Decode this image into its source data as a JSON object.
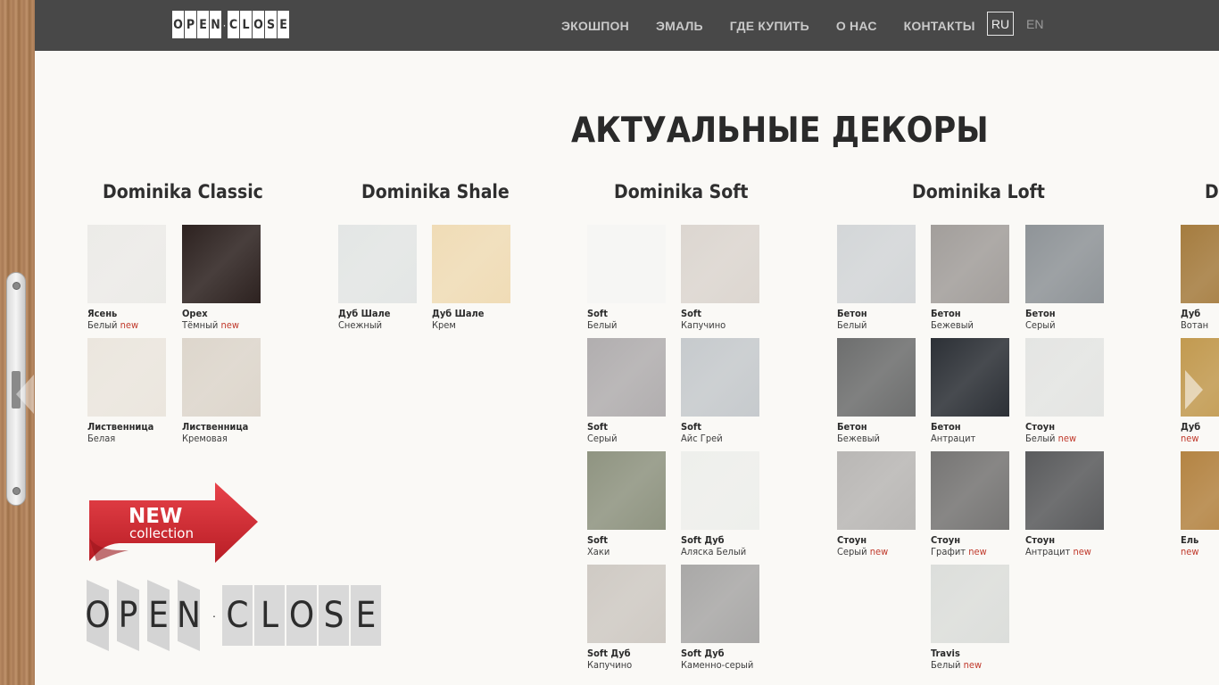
{
  "header": {
    "logo_letters": [
      "O",
      "P",
      "E",
      "N",
      "C",
      "L",
      "O",
      "S",
      "E"
    ],
    "logo_separator": "·",
    "nav": [
      "ЭКОШПОН",
      "ЭМАЛЬ",
      "ГДЕ КУПИТЬ",
      "О НАС",
      "КОНТАКТЫ"
    ],
    "lang_active": "RU",
    "lang_other": "EN"
  },
  "page_title": "АКТУАЛЬНЫЕ ДЕКОРЫ",
  "columns": [
    {
      "title": "Dominika Classic",
      "swatches": [
        {
          "name": "Ясень",
          "sub": "Белый",
          "is_new": true,
          "color": "#ecebe8"
        },
        {
          "name": "Орех",
          "sub": "Тёмный",
          "is_new": true,
          "color": "#2d2220"
        },
        {
          "name": "Лиственница",
          "sub": "Белая",
          "is_new": false,
          "color": "#ebe6de"
        },
        {
          "name": "Лиственница",
          "sub": "Кремовая",
          "is_new": false,
          "color": "#ddd6cc"
        }
      ]
    },
    {
      "title": "Dominika Shale",
      "swatches": [
        {
          "name": "Дуб Шале",
          "sub": "Снежный",
          "is_new": false,
          "color": "#e3e6e5"
        },
        {
          "name": "Дуб Шале",
          "sub": "Крем",
          "is_new": false,
          "color": "#f0dcb6"
        }
      ]
    },
    {
      "title": "Dominika Soft",
      "swatches": [
        {
          "name": "Soft",
          "sub": "Белый",
          "is_new": false,
          "color": "#f6f6f4"
        },
        {
          "name": "Soft",
          "sub": "Капучино",
          "is_new": false,
          "color": "#dcd6d0"
        },
        {
          "name": "Soft",
          "sub": "Серый",
          "is_new": false,
          "color": "#b1aeaf"
        },
        {
          "name": "Soft",
          "sub": "Айс Грей",
          "is_new": false,
          "color": "#c6cacd"
        },
        {
          "name": "Soft",
          "sub": "Хаки",
          "is_new": false,
          "color": "#8f9481"
        },
        {
          "name": "Soft Дуб",
          "sub": "Аляска Белый",
          "is_new": false,
          "color": "#eeefec"
        },
        {
          "name": "Soft Дуб",
          "sub": "Капучино",
          "is_new": false,
          "color": "#cfcac4"
        },
        {
          "name": "Soft Дуб",
          "sub": "Каменно-серый",
          "is_new": false,
          "color": "#a9a8a7"
        }
      ]
    },
    {
      "title": "Dominika Loft",
      "swatches": [
        {
          "name": "Бетон",
          "sub": "Белый",
          "is_new": false,
          "color": "#d3d6d8"
        },
        {
          "name": "Бетон",
          "sub": "Бежевый",
          "is_new": false,
          "color": "#a29e9b"
        },
        {
          "name": "Бетон",
          "sub": "Серый",
          "is_new": false,
          "color": "#8f9498"
        },
        {
          "name": "Бетон",
          "sub": "Бежевый",
          "is_new": false,
          "color": "#6d6e6e"
        },
        {
          "name": "Бетон",
          "sub": "Антрацит",
          "is_new": false,
          "color": "#2c3036"
        },
        {
          "name": "Стоун",
          "sub": "Белый",
          "is_new": true,
          "color": "#e4e5e3"
        },
        {
          "name": "Стоун",
          "sub": "Серый",
          "is_new": true,
          "color": "#b9b7b5"
        },
        {
          "name": "Стоун",
          "sub": "Графит",
          "is_new": true,
          "color": "#767574"
        },
        {
          "name": "Стоун",
          "sub": "Антрацит",
          "is_new": true,
          "color": "#5a5b5d"
        },
        {
          "name": "Travis",
          "sub": "Белый",
          "is_new": true,
          "color": "#dcdedb"
        }
      ]
    },
    {
      "title": "Do",
      "swatches": [
        {
          "name": "Дуб",
          "sub": "Вотан",
          "is_new": false,
          "color": "#a57c3f"
        },
        {
          "name": "Дуб",
          "sub": "",
          "is_new": true,
          "color": "#c29a50"
        },
        {
          "name": "Ель",
          "sub": "",
          "is_new": true,
          "color": "#b48443"
        }
      ]
    }
  ],
  "new_label": "new",
  "badge": {
    "word": "NEW",
    "sub": "collection",
    "color": "#d7282f"
  },
  "big_logo": {
    "letters": [
      "O",
      "P",
      "E",
      "N",
      "C",
      "L",
      "O",
      "S",
      "E"
    ],
    "separator": "·"
  }
}
